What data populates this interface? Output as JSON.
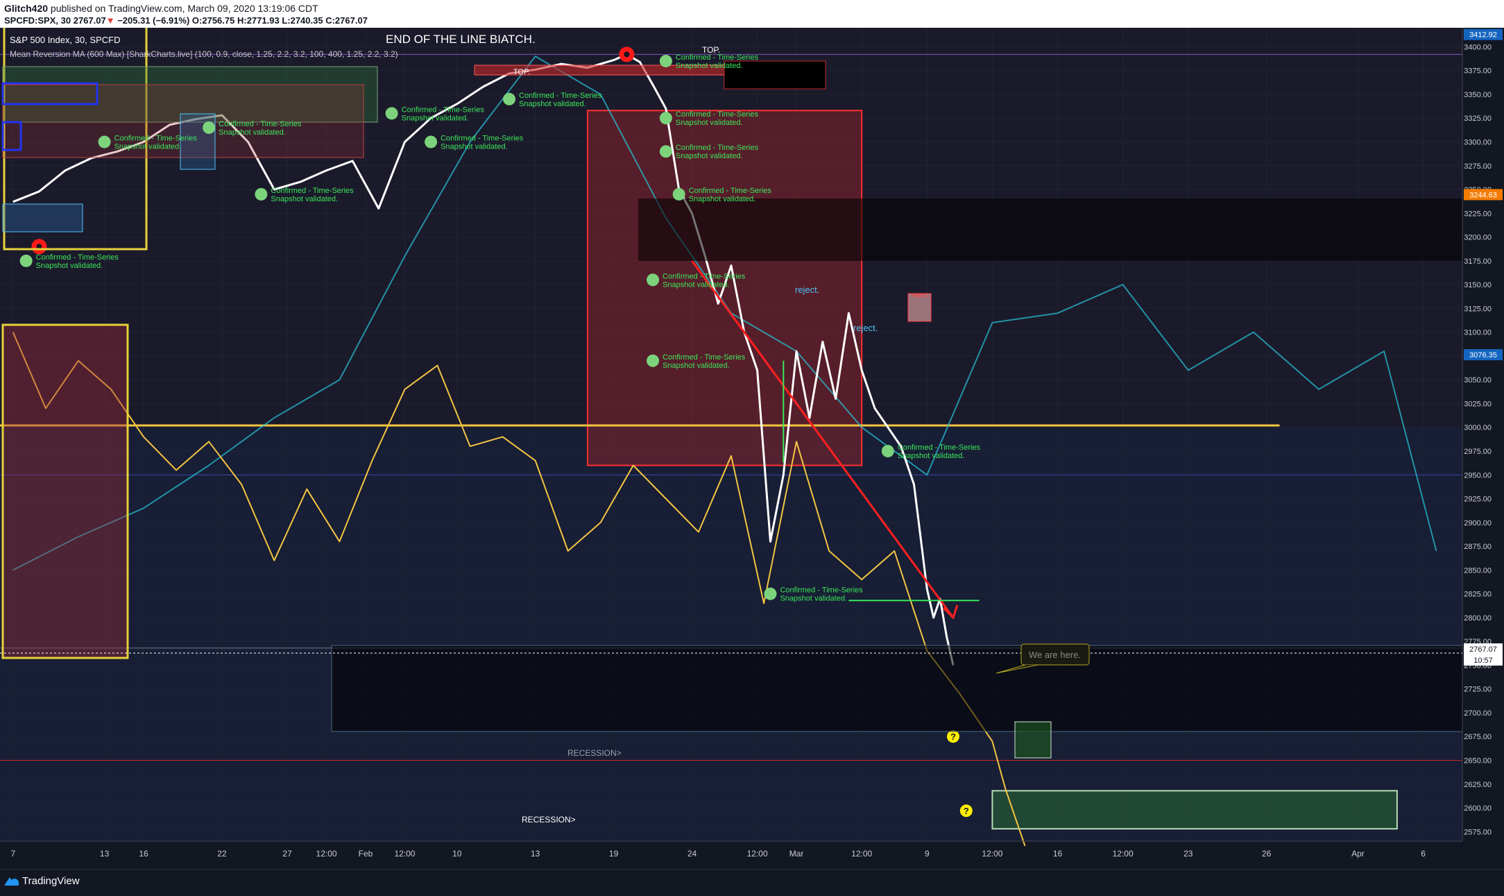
{
  "header": {
    "author": "Glitch420",
    "published_text": "published on TradingView.com, March 09, 2020 13:19:06 CDT",
    "symbol": "SPCFD:SPX, 30",
    "last": "2767.07",
    "change": "−205.31 (−6.91%)",
    "open": "O:2756.75",
    "high": "H:2771.93",
    "low": "L:2740.35",
    "close": "C:2767.07"
  },
  "legend": {
    "title": "S&P 500 Index, 30, SPCFD",
    "indicator": "Mean Reversion MA (600 Max) [SharkCharts.live] (100, 0.9, close, 1.25, 2.2, 3.2, 100, 400, 1.25, 2.2, 3.2)"
  },
  "annotations": {
    "headline": "END OF THE LINE BIATCH.",
    "top_label": "TOP.",
    "reject_label": "reject.",
    "confirmed_label": "Confirmed - Time-Series Snapshot validated.",
    "we_are_here": "We are here.",
    "recession_label": "RECESSION>",
    "question_icon": "question-icon",
    "check_icon": "check-circle-icon"
  },
  "price_badges": {
    "top": "3412.92",
    "upper": "3244.63",
    "mid": "3076.35",
    "last": "2767.07",
    "countdown": "10:57"
  },
  "footer": {
    "brand": "TradingView"
  },
  "colors": {
    "background": "#131722",
    "price_line": "#ffffff",
    "forecast": "#f4c542",
    "cycle_line": "#26c6da",
    "confirm_text": "#3ce65a",
    "red_zone": "#c62828",
    "green_zone": "#2e7d32",
    "badge_orange": "#f57c00",
    "badge_blue": "#1565c0"
  },
  "chart_data": {
    "type": "line",
    "title": "S&P 500 Index, 30, SPCFD",
    "ylim": [
      2565,
      3420
    ],
    "y_ticks": [
      2575,
      2600,
      2625,
      2650,
      2675,
      2700,
      2725,
      2750,
      2775,
      2800,
      2825,
      2850,
      2875,
      2900,
      2925,
      2950,
      2975,
      3000,
      3025,
      3050,
      3075,
      3100,
      3125,
      3150,
      3175,
      3200,
      3225,
      3250,
      3275,
      3300,
      3325,
      3350,
      3375,
      3400
    ],
    "x_ticks": [
      "7",
      "13",
      "16",
      "22",
      "27",
      "12:00",
      "Feb",
      "12:00",
      "10",
      "13",
      "19",
      "24",
      "12:00",
      "Mar",
      "12:00",
      "9",
      "12:00",
      "16",
      "12:00",
      "23",
      "26",
      "Apr",
      "6"
    ],
    "x_ticks_idx": [
      0,
      14,
      20,
      32,
      42,
      48,
      54,
      60,
      68,
      80,
      92,
      104,
      114,
      120,
      130,
      140,
      150,
      160,
      170,
      180,
      192,
      206,
      216
    ],
    "x_range": [
      -2,
      222
    ],
    "grid": true,
    "series": [
      {
        "key": "price",
        "x": [
          0,
          4,
          8,
          12,
          16,
          20,
          24,
          28,
          32,
          36,
          40,
          44,
          48,
          52,
          56,
          60,
          64,
          68,
          72,
          76,
          80,
          84,
          88,
          92,
          94,
          96,
          98,
          100,
          102,
          104,
          106,
          108,
          110,
          112,
          114,
          116,
          118,
          120,
          122,
          124,
          126,
          128,
          130,
          132,
          134,
          136,
          138,
          140,
          141,
          142,
          143,
          144
        ],
        "y": [
          3237,
          3248,
          3270,
          3283,
          3290,
          3300,
          3318,
          3324,
          3328,
          3300,
          3250,
          3258,
          3270,
          3280,
          3230,
          3300,
          3325,
          3340,
          3358,
          3372,
          3376,
          3382,
          3378,
          3386,
          3392,
          3384,
          3360,
          3335,
          3250,
          3225,
          3180,
          3130,
          3170,
          3100,
          3060,
          2880,
          2950,
          3080,
          3010,
          3090,
          3030,
          3120,
          3060,
          3020,
          3000,
          2980,
          2940,
          2830,
          2800,
          2820,
          2780,
          2750
        ]
      },
      {
        "key": "forecast",
        "x": [
          0,
          5,
          10,
          15,
          20,
          25,
          30,
          35,
          40,
          45,
          50,
          55,
          60,
          65,
          70,
          75,
          80,
          85,
          90,
          95,
          100,
          105,
          110,
          115,
          120,
          125,
          130,
          135,
          140,
          145,
          150,
          152,
          155
        ],
        "y": [
          3100,
          3020,
          3070,
          3040,
          2990,
          2955,
          2985,
          2940,
          2860,
          2935,
          2880,
          2965,
          3040,
          3065,
          2980,
          2990,
          2965,
          2870,
          2900,
          2960,
          2925,
          2890,
          2970,
          2815,
          2985,
          2870,
          2840,
          2870,
          2765,
          2720,
          2670,
          2620,
          2560
        ]
      },
      {
        "key": "cycle",
        "x": [
          0,
          10,
          20,
          30,
          40,
          50,
          60,
          70,
          80,
          90,
          100,
          110,
          120,
          130,
          140,
          150,
          160,
          170,
          180,
          190,
          200,
          210,
          218
        ],
        "y": [
          2850,
          2885,
          2915,
          2960,
          3010,
          3050,
          3180,
          3300,
          3390,
          3350,
          3220,
          3120,
          3080,
          3000,
          2950,
          3110,
          3120,
          3150,
          3060,
          3100,
          3040,
          3080,
          2870
        ]
      }
    ],
    "levels": [
      {
        "y": 3002,
        "label": ""
      },
      {
        "y": 2768,
        "label": ""
      }
    ],
    "zones": [
      {
        "x0": 88,
        "x1": 130,
        "y0": 2960,
        "y1": 3333,
        "label": ""
      },
      {
        "x0": 150,
        "x1": 212,
        "y0": 2578,
        "y1": 2618,
        "label": ""
      }
    ]
  }
}
